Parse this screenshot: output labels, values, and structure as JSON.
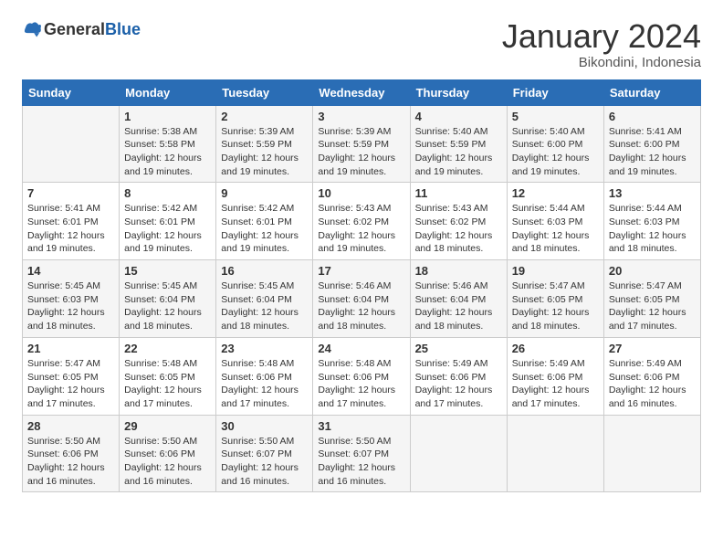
{
  "header": {
    "logo": {
      "general": "General",
      "blue": "Blue"
    },
    "title": "January 2024",
    "location": "Bikondini, Indonesia"
  },
  "days_of_week": [
    "Sunday",
    "Monday",
    "Tuesday",
    "Wednesday",
    "Thursday",
    "Friday",
    "Saturday"
  ],
  "weeks": [
    [
      {
        "day": "",
        "content": ""
      },
      {
        "day": "1",
        "content": "Sunrise: 5:38 AM\nSunset: 5:58 PM\nDaylight: 12 hours and 19 minutes."
      },
      {
        "day": "2",
        "content": "Sunrise: 5:39 AM\nSunset: 5:59 PM\nDaylight: 12 hours and 19 minutes."
      },
      {
        "day": "3",
        "content": "Sunrise: 5:39 AM\nSunset: 5:59 PM\nDaylight: 12 hours and 19 minutes."
      },
      {
        "day": "4",
        "content": "Sunrise: 5:40 AM\nSunset: 5:59 PM\nDaylight: 12 hours and 19 minutes."
      },
      {
        "day": "5",
        "content": "Sunrise: 5:40 AM\nSunset: 6:00 PM\nDaylight: 12 hours and 19 minutes."
      },
      {
        "day": "6",
        "content": "Sunrise: 5:41 AM\nSunset: 6:00 PM\nDaylight: 12 hours and 19 minutes."
      }
    ],
    [
      {
        "day": "7",
        "content": "Sunrise: 5:41 AM\nSunset: 6:01 PM\nDaylight: 12 hours and 19 minutes."
      },
      {
        "day": "8",
        "content": "Sunrise: 5:42 AM\nSunset: 6:01 PM\nDaylight: 12 hours and 19 minutes."
      },
      {
        "day": "9",
        "content": "Sunrise: 5:42 AM\nSunset: 6:01 PM\nDaylight: 12 hours and 19 minutes."
      },
      {
        "day": "10",
        "content": "Sunrise: 5:43 AM\nSunset: 6:02 PM\nDaylight: 12 hours and 19 minutes."
      },
      {
        "day": "11",
        "content": "Sunrise: 5:43 AM\nSunset: 6:02 PM\nDaylight: 12 hours and 18 minutes."
      },
      {
        "day": "12",
        "content": "Sunrise: 5:44 AM\nSunset: 6:03 PM\nDaylight: 12 hours and 18 minutes."
      },
      {
        "day": "13",
        "content": "Sunrise: 5:44 AM\nSunset: 6:03 PM\nDaylight: 12 hours and 18 minutes."
      }
    ],
    [
      {
        "day": "14",
        "content": "Sunrise: 5:45 AM\nSunset: 6:03 PM\nDaylight: 12 hours and 18 minutes."
      },
      {
        "day": "15",
        "content": "Sunrise: 5:45 AM\nSunset: 6:04 PM\nDaylight: 12 hours and 18 minutes."
      },
      {
        "day": "16",
        "content": "Sunrise: 5:45 AM\nSunset: 6:04 PM\nDaylight: 12 hours and 18 minutes."
      },
      {
        "day": "17",
        "content": "Sunrise: 5:46 AM\nSunset: 6:04 PM\nDaylight: 12 hours and 18 minutes."
      },
      {
        "day": "18",
        "content": "Sunrise: 5:46 AM\nSunset: 6:04 PM\nDaylight: 12 hours and 18 minutes."
      },
      {
        "day": "19",
        "content": "Sunrise: 5:47 AM\nSunset: 6:05 PM\nDaylight: 12 hours and 18 minutes."
      },
      {
        "day": "20",
        "content": "Sunrise: 5:47 AM\nSunset: 6:05 PM\nDaylight: 12 hours and 17 minutes."
      }
    ],
    [
      {
        "day": "21",
        "content": "Sunrise: 5:47 AM\nSunset: 6:05 PM\nDaylight: 12 hours and 17 minutes."
      },
      {
        "day": "22",
        "content": "Sunrise: 5:48 AM\nSunset: 6:05 PM\nDaylight: 12 hours and 17 minutes."
      },
      {
        "day": "23",
        "content": "Sunrise: 5:48 AM\nSunset: 6:06 PM\nDaylight: 12 hours and 17 minutes."
      },
      {
        "day": "24",
        "content": "Sunrise: 5:48 AM\nSunset: 6:06 PM\nDaylight: 12 hours and 17 minutes."
      },
      {
        "day": "25",
        "content": "Sunrise: 5:49 AM\nSunset: 6:06 PM\nDaylight: 12 hours and 17 minutes."
      },
      {
        "day": "26",
        "content": "Sunrise: 5:49 AM\nSunset: 6:06 PM\nDaylight: 12 hours and 17 minutes."
      },
      {
        "day": "27",
        "content": "Sunrise: 5:49 AM\nSunset: 6:06 PM\nDaylight: 12 hours and 16 minutes."
      }
    ],
    [
      {
        "day": "28",
        "content": "Sunrise: 5:50 AM\nSunset: 6:06 PM\nDaylight: 12 hours and 16 minutes."
      },
      {
        "day": "29",
        "content": "Sunrise: 5:50 AM\nSunset: 6:06 PM\nDaylight: 12 hours and 16 minutes."
      },
      {
        "day": "30",
        "content": "Sunrise: 5:50 AM\nSunset: 6:07 PM\nDaylight: 12 hours and 16 minutes."
      },
      {
        "day": "31",
        "content": "Sunrise: 5:50 AM\nSunset: 6:07 PM\nDaylight: 12 hours and 16 minutes."
      },
      {
        "day": "",
        "content": ""
      },
      {
        "day": "",
        "content": ""
      },
      {
        "day": "",
        "content": ""
      }
    ]
  ]
}
